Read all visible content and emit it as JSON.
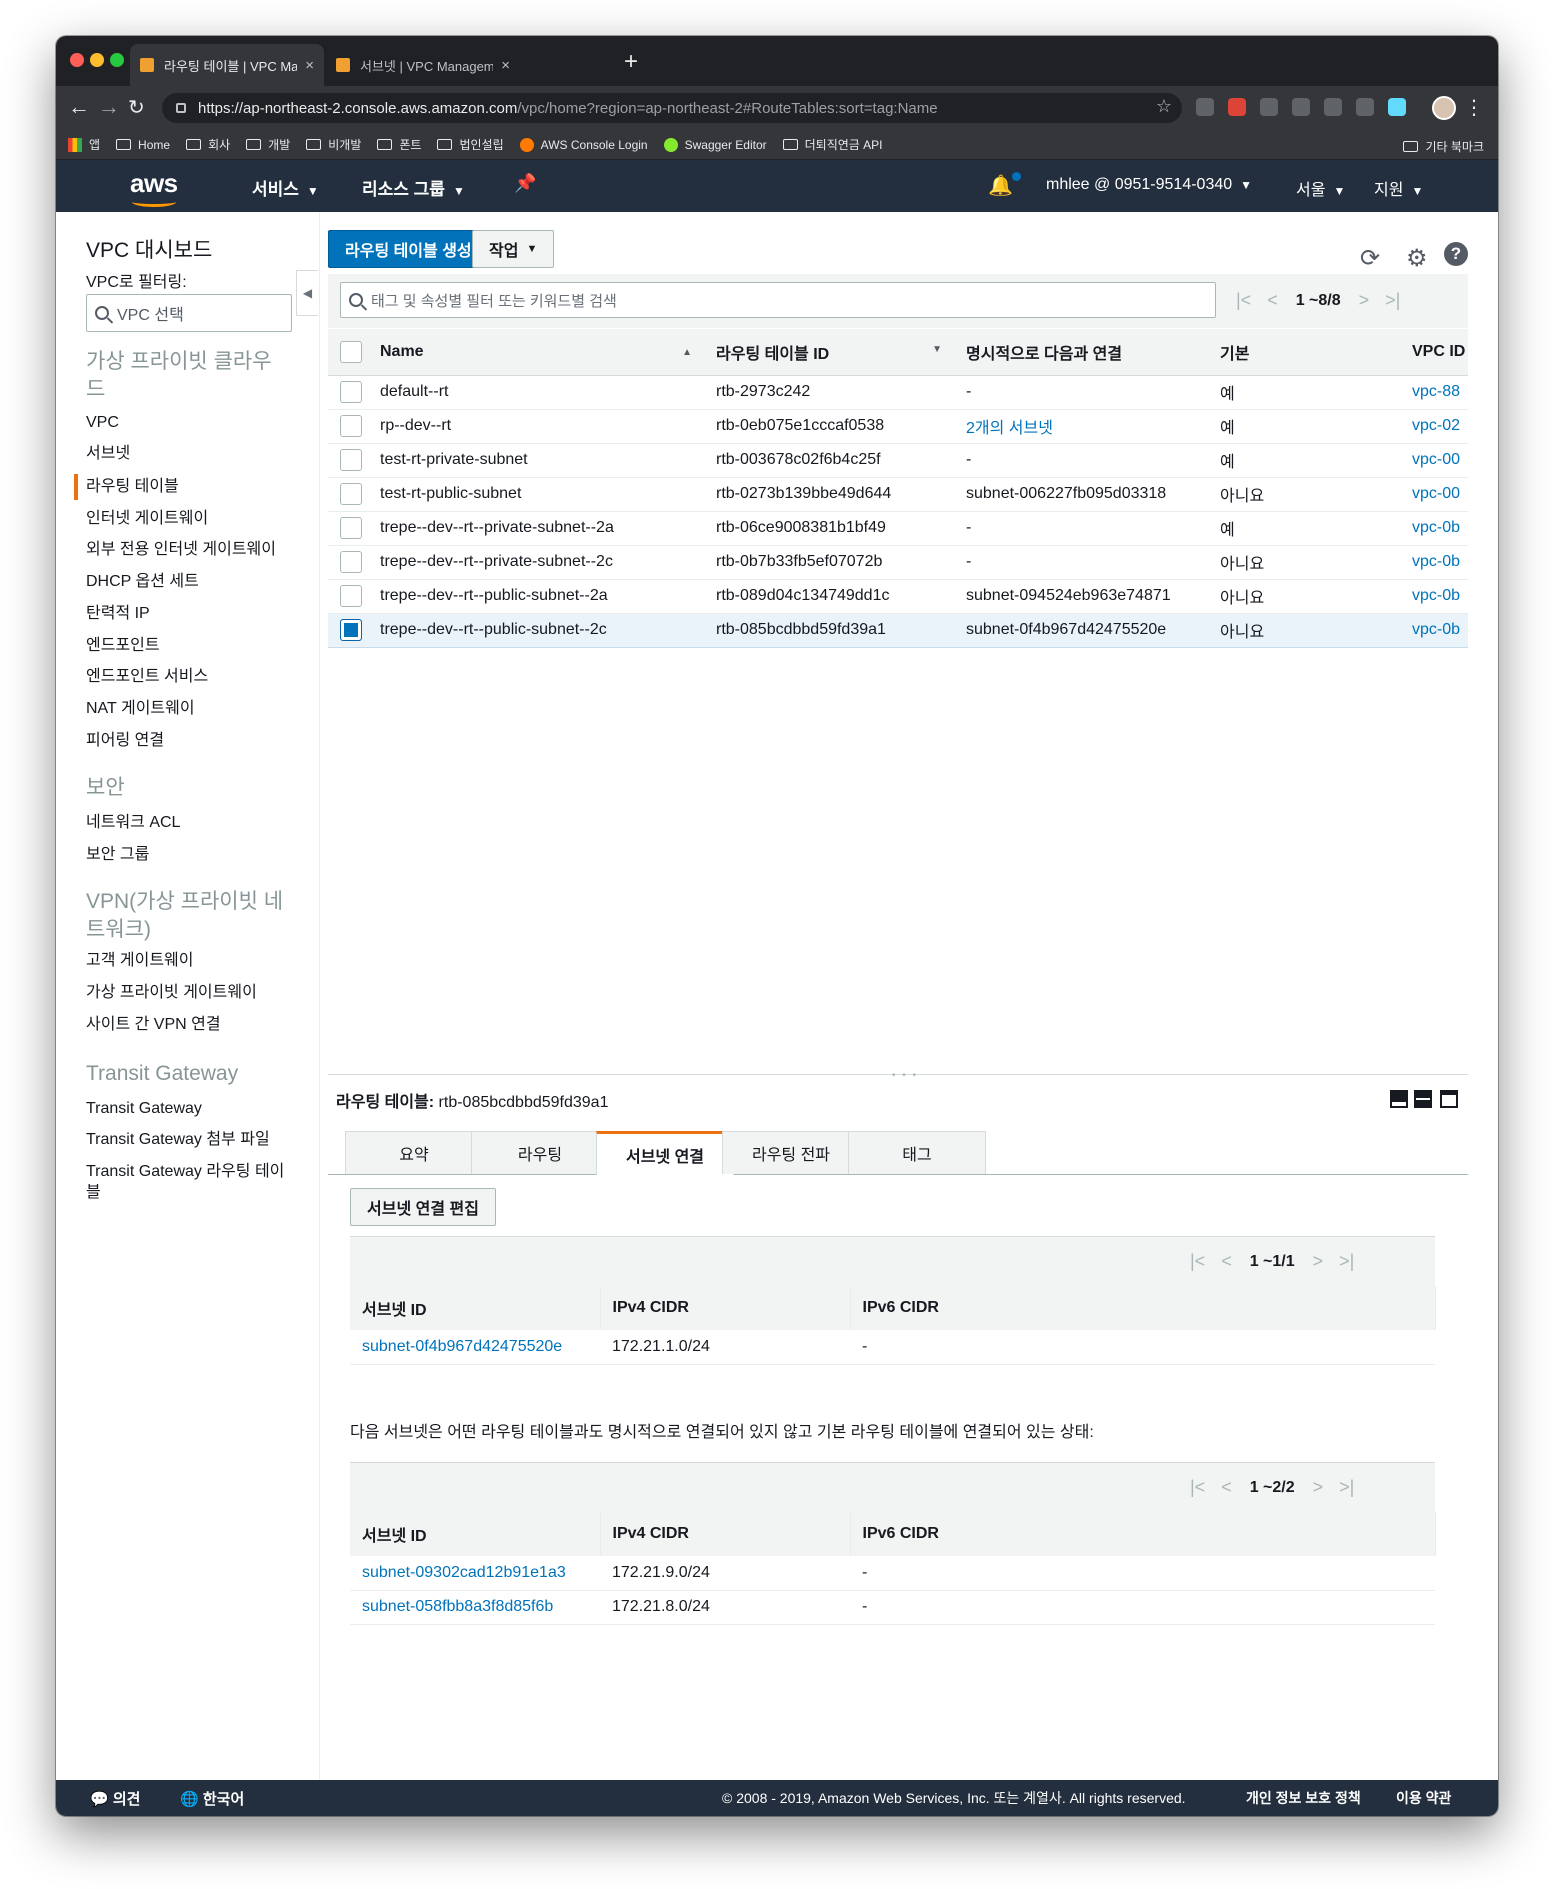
{
  "browser": {
    "tabs": [
      {
        "title": "라우팅 테이블 | VPC Management Console"
      },
      {
        "title": "서브넷 | VPC Management Console"
      }
    ],
    "url_host": "https://ap-northeast-2.console.aws.amazon.com",
    "url_path": "/vpc/home?region=ap-northeast-2#RouteTables:sort=tag:Name",
    "bookmarks": [
      "앱",
      "Home",
      "회사",
      "개발",
      "비개발",
      "폰트",
      "법인설립",
      "AWS Console Login",
      "Swagger Editor",
      "더퇴직연금 API"
    ],
    "bookmarks_other": "기타 북마크"
  },
  "header": {
    "logo": "aws",
    "services": "서비스",
    "resource_groups": "리소스 그룹",
    "account": "mhlee @ 0951-9514-0340",
    "region": "서울",
    "support": "지원"
  },
  "sidebar": {
    "dashboard": "VPC 대시보드",
    "filter_label": "VPC로 필터링:",
    "filter_placeholder": "VPC 선택",
    "sections": [
      {
        "title": "가상 프라이빗 클라우드",
        "items": [
          "VPC",
          "서브넷",
          "라우팅 테이블",
          "인터넷 게이트웨이",
          "외부 전용 인터넷 게이트웨이",
          "DHCP 옵션 세트",
          "탄력적 IP",
          "엔드포인트",
          "엔드포인트 서비스",
          "NAT 게이트웨이",
          "피어링 연결"
        ]
      },
      {
        "title": "보안",
        "items": [
          "네트워크 ACL",
          "보안 그룹"
        ]
      },
      {
        "title": "VPN(가상 프라이빗 네트워크)",
        "items": [
          "고객 게이트웨이",
          "가상 프라이빗 게이트웨이",
          "사이트 간 VPN 연결"
        ]
      },
      {
        "title": "Transit Gateway",
        "items": [
          "Transit Gateway",
          "Transit Gateway 첨부 파일",
          "Transit Gateway 라우팅 테이블"
        ]
      }
    ],
    "active_item": "라우팅 테이블"
  },
  "toolbar": {
    "create_label": "라우팅 테이블 생성",
    "actions_label": "작업"
  },
  "list": {
    "search_placeholder": "태그 및 속성별 필터 또는 키워드별 검색",
    "pagination": "1 ~8/8",
    "columns": [
      "Name",
      "라우팅 테이블 ID",
      "명시적으로 다음과 연결",
      "기본",
      "VPC ID"
    ],
    "rows": [
      {
        "name": "default--rt",
        "id": "rtb-2973c242",
        "assoc": "-",
        "main": "예",
        "vpc": "vpc-88",
        "selected": false
      },
      {
        "name": "rp--dev--rt",
        "id": "rtb-0eb075e1cccaf0538",
        "assoc": "2개의 서브넷",
        "main": "예",
        "vpc": "vpc-02",
        "selected": false
      },
      {
        "name": "test-rt-private-subnet",
        "id": "rtb-003678c02f6b4c25f",
        "assoc": "-",
        "main": "예",
        "vpc": "vpc-00",
        "selected": false
      },
      {
        "name": "test-rt-public-subnet",
        "id": "rtb-0273b139bbe49d644",
        "assoc": "subnet-006227fb095d03318",
        "main": "아니요",
        "vpc": "vpc-00",
        "selected": false
      },
      {
        "name": "trepe--dev--rt--private-subnet--2a",
        "id": "rtb-06ce9008381b1bf49",
        "assoc": "-",
        "main": "예",
        "vpc": "vpc-0b",
        "selected": false
      },
      {
        "name": "trepe--dev--rt--private-subnet--2c",
        "id": "rtb-0b7b33fb5ef07072b",
        "assoc": "-",
        "main": "아니요",
        "vpc": "vpc-0b",
        "selected": false
      },
      {
        "name": "trepe--dev--rt--public-subnet--2a",
        "id": "rtb-089d04c134749dd1c",
        "assoc": "subnet-094524eb963e74871",
        "main": "아니요",
        "vpc": "vpc-0b",
        "selected": false
      },
      {
        "name": "trepe--dev--rt--public-subnet--2c",
        "id": "rtb-085bcdbbd59fd39a1",
        "assoc": "subnet-0f4b967d42475520e",
        "main": "아니요",
        "vpc": "vpc-0b",
        "selected": true
      }
    ]
  },
  "detail": {
    "title_label": "라우팅 테이블:",
    "title_value": "rtb-085bcdbbd59fd39a1",
    "tabs": [
      "요약",
      "라우팅",
      "서브넷 연결",
      "라우팅 전파",
      "태그"
    ],
    "active_tab": "서브넷 연결",
    "edit_button": "서브넷 연결 편집",
    "assoc_pagination": "1 ~1/1",
    "columns": [
      "서브넷 ID",
      "IPv4 CIDR",
      "IPv6 CIDR"
    ],
    "assoc_rows": [
      {
        "subnet": "subnet-0f4b967d42475520e",
        "ipv4": "172.21.1.0/24",
        "ipv6": "-"
      }
    ],
    "note": "다음 서브넷은 어떤 라우팅 테이블과도 명시적으로 연결되어 있지 않고 기본 라우팅 테이블에 연결되어 있는 상태:",
    "unassoc_pagination": "1 ~2/2",
    "unassoc_rows": [
      {
        "subnet": "subnet-09302cad12b91e1a3",
        "ipv4": "172.21.9.0/24",
        "ipv6": "-"
      },
      {
        "subnet": "subnet-058fbb8a3f8d85f6b",
        "ipv4": "172.21.8.0/24",
        "ipv6": "-"
      }
    ]
  },
  "footer": {
    "feedback": "의견",
    "language": "한국어",
    "copyright": "© 2008 - 2019, Amazon Web Services, Inc. 또는 계열사. All rights reserved.",
    "privacy": "개인 정보 보호 정책",
    "terms": "이용 약관"
  },
  "colors": {
    "aws_nav": "#232f3e",
    "primary": "#0073bb",
    "accent": "#ec7211"
  }
}
